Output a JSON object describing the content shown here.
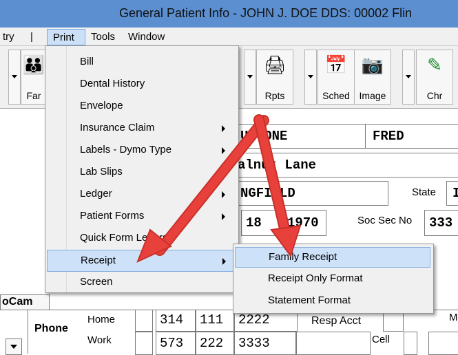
{
  "window": {
    "title": "General Patient Info - JOHN J. DOE DDS: 00002 Flin"
  },
  "menubar": {
    "items": [
      {
        "label": "try"
      },
      {
        "label": "|"
      },
      {
        "label": "Print"
      },
      {
        "label": "Tools"
      },
      {
        "label": "Window"
      }
    ]
  },
  "toolbar": {
    "buttons": [
      {
        "label": "Far",
        "icon": "family-icon"
      },
      {
        "label": "Rpts",
        "icon": "printer-icon"
      },
      {
        "label": "Sched",
        "icon": "calendar-icon"
      },
      {
        "label": "Image",
        "icon": "camera-icon"
      },
      {
        "label": "Chr",
        "icon": "probe-icon"
      }
    ]
  },
  "print_menu": {
    "items": [
      {
        "label": "Bill",
        "submenu": false
      },
      {
        "label": "Dental History",
        "submenu": false
      },
      {
        "label": "Envelope",
        "submenu": false
      },
      {
        "label": "Insurance Claim",
        "submenu": true
      },
      {
        "label": "Labels - Dymo Type",
        "submenu": true
      },
      {
        "label": "Lab Slips",
        "submenu": false
      },
      {
        "label": "Ledger",
        "submenu": true
      },
      {
        "label": "Patient Forms",
        "submenu": true
      },
      {
        "label": "Quick Form Letters",
        "submenu": false
      },
      {
        "label": "Receipt",
        "submenu": true,
        "selected": true
      },
      {
        "label": "Screen",
        "submenu": false
      }
    ]
  },
  "receipt_submenu": {
    "items": [
      {
        "label": "Family Receipt",
        "selected": true
      },
      {
        "label": "Receipt Only Format"
      },
      {
        "label": "Statement Format"
      }
    ]
  },
  "patient": {
    "last_name": "UTTONE",
    "first_name": "FRED",
    "address": "alnut Lane",
    "city": "NGFIELD",
    "state_label": "State",
    "state_value": "I",
    "dob_day": "18",
    "dob_year": "1970",
    "ssn_label": "Soc Sec No",
    "ssn_value": "333"
  },
  "phone": {
    "section_label": "Phone",
    "home_label": "Home",
    "work_label": "Work",
    "home": [
      "314",
      "111",
      "2222"
    ],
    "work": [
      "573",
      "222",
      "3333"
    ],
    "resp_acct_label": "Resp Acct",
    "cell_label": "Cell",
    "m_label": "M"
  },
  "tab": {
    "label": "oCam"
  },
  "colors": {
    "arrow": "#e8403a",
    "menu_highlight": "#cde1f8",
    "titlebar": "#5b8fd0"
  }
}
